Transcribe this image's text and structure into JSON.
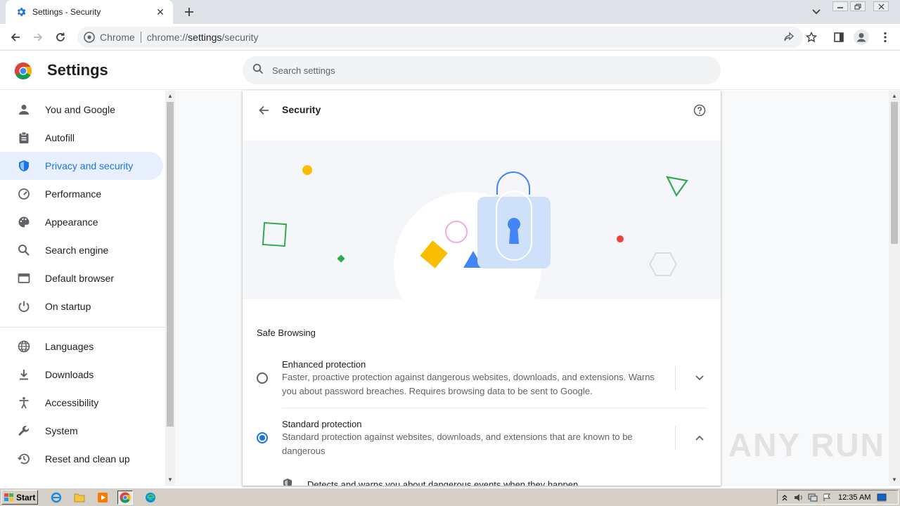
{
  "browser": {
    "tab_title": "Settings - Security",
    "tab_close_glyph": "✕",
    "new_tab_glyph": "+",
    "omnibox_origin": "Chrome",
    "url_prefix": "chrome://",
    "url_host": "settings",
    "url_path": "/security"
  },
  "header": {
    "title": "Settings",
    "search_placeholder": "Search settings"
  },
  "sidebar": {
    "items": [
      {
        "label": "You and Google",
        "icon": "person-icon"
      },
      {
        "label": "Autofill",
        "icon": "clipboard-icon"
      },
      {
        "label": "Privacy and security",
        "icon": "shield-icon",
        "active": true
      },
      {
        "label": "Performance",
        "icon": "speedometer-icon"
      },
      {
        "label": "Appearance",
        "icon": "palette-icon"
      },
      {
        "label": "Search engine",
        "icon": "search-icon"
      },
      {
        "label": "Default browser",
        "icon": "browser-window-icon"
      },
      {
        "label": "On startup",
        "icon": "power-icon"
      },
      {
        "label": "Languages",
        "icon": "globe-icon"
      },
      {
        "label": "Downloads",
        "icon": "download-icon"
      },
      {
        "label": "Accessibility",
        "icon": "accessibility-icon"
      },
      {
        "label": "System",
        "icon": "wrench-icon"
      },
      {
        "label": "Reset and clean up",
        "icon": "history-icon"
      }
    ]
  },
  "main": {
    "section_title": "Security",
    "safe_browsing_heading": "Safe Browsing",
    "options": [
      {
        "title": "Enhanced protection",
        "description": "Faster, proactive protection against dangerous websites, downloads, and extensions. Warns you about password breaches. Requires browsing data to be sent to Google.",
        "selected": false,
        "expanded": false
      },
      {
        "title": "Standard protection",
        "description": "Standard protection against websites, downloads, and extensions that are known to be dangerous",
        "selected": true,
        "expanded": true
      }
    ],
    "standard_detail": "Detects and warns you about dangerous events when they happen"
  },
  "watermark": "ANY RUN",
  "taskbar": {
    "start_label": "Start",
    "clock": "12:35 AM"
  },
  "colors": {
    "accent": "#1a73e8",
    "active_nav_bg": "#e8f0fe",
    "banner_bg": "#f4f6fa"
  }
}
